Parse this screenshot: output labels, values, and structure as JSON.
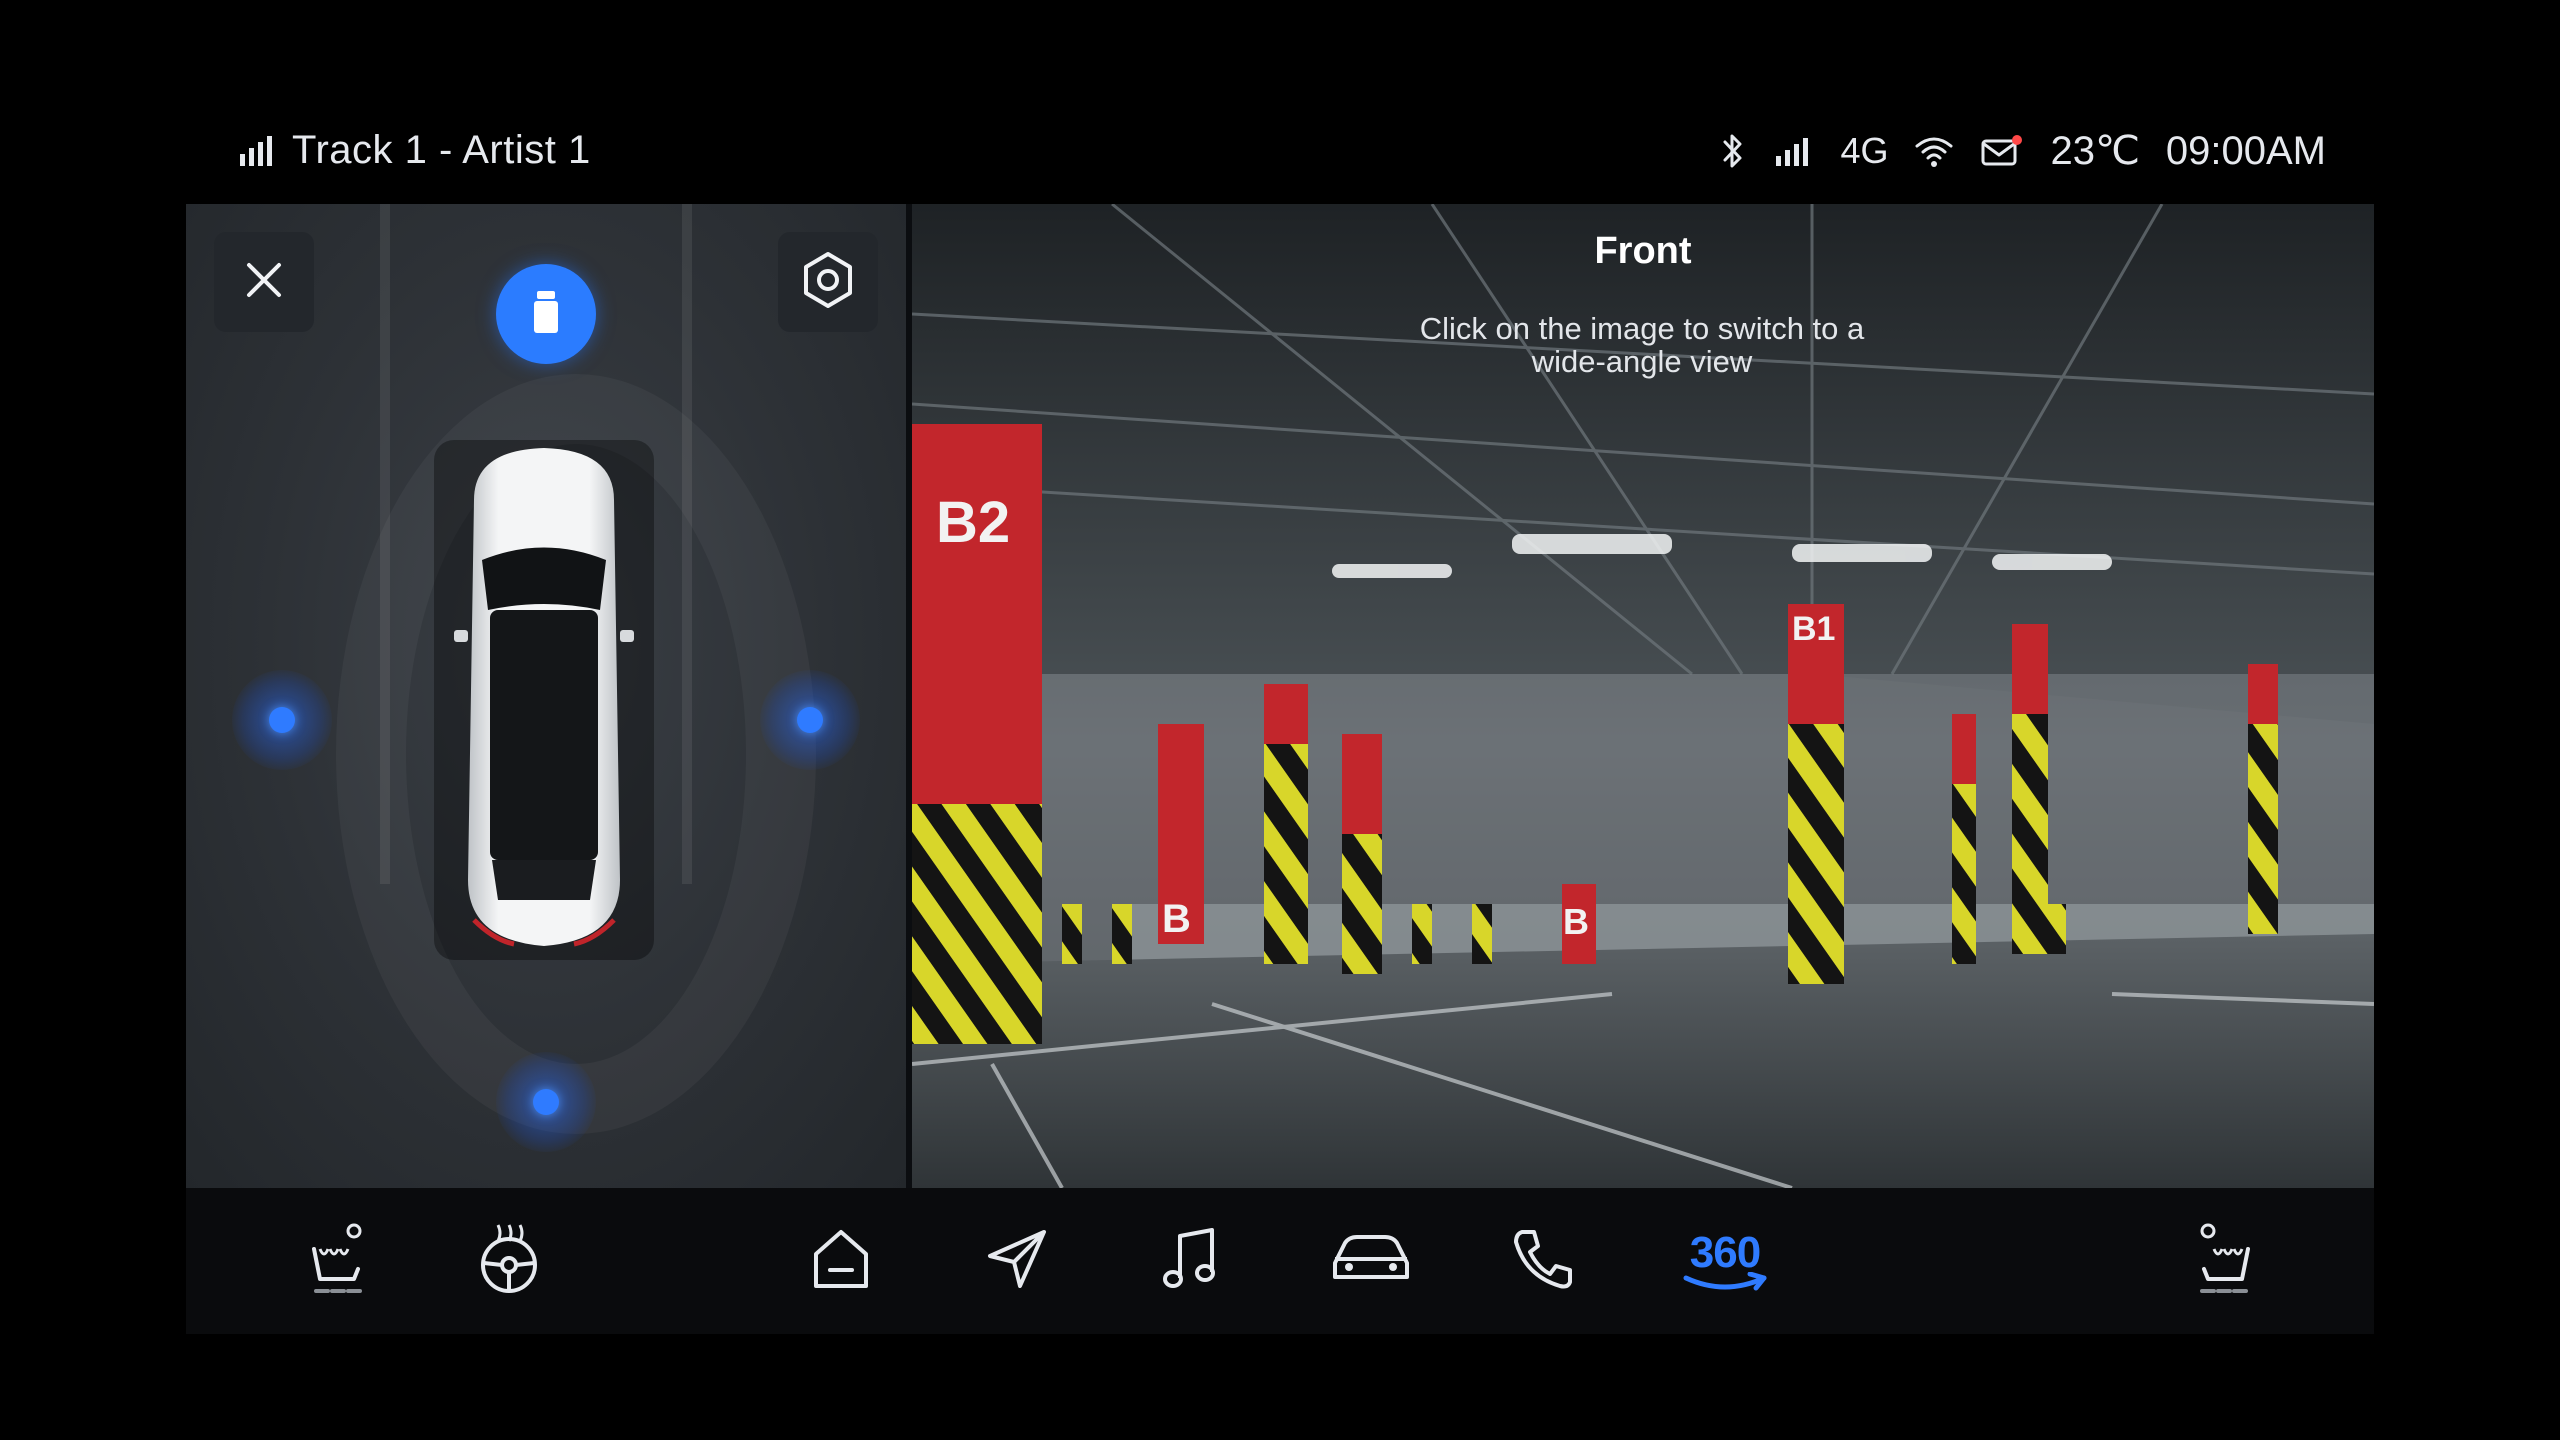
{
  "status_bar": {
    "media_icon": "signal-bars-icon",
    "media_title": "Track 1 - Artist 1",
    "network": "4G",
    "temperature": "23℃",
    "time": "09:00AM",
    "icons": [
      "bluetooth-icon",
      "cell-signal-icon",
      "wifi-icon",
      "mail-icon"
    ]
  },
  "parking_view": {
    "close_icon": "close-icon",
    "settings_icon": "settings-icon",
    "active_camera": "front"
  },
  "camera": {
    "title": "Front",
    "hint": "Click on the image to switch to a wide-angle view"
  },
  "dock": {
    "items": [
      "seat-heat-left-icon",
      "steering-heat-icon",
      "home-icon",
      "navigation-icon",
      "music-icon",
      "car-icon",
      "phone-icon",
      "360-view-icon",
      "seat-heat-right-icon"
    ],
    "badge_360": "360",
    "accent": "#2f7bff"
  }
}
